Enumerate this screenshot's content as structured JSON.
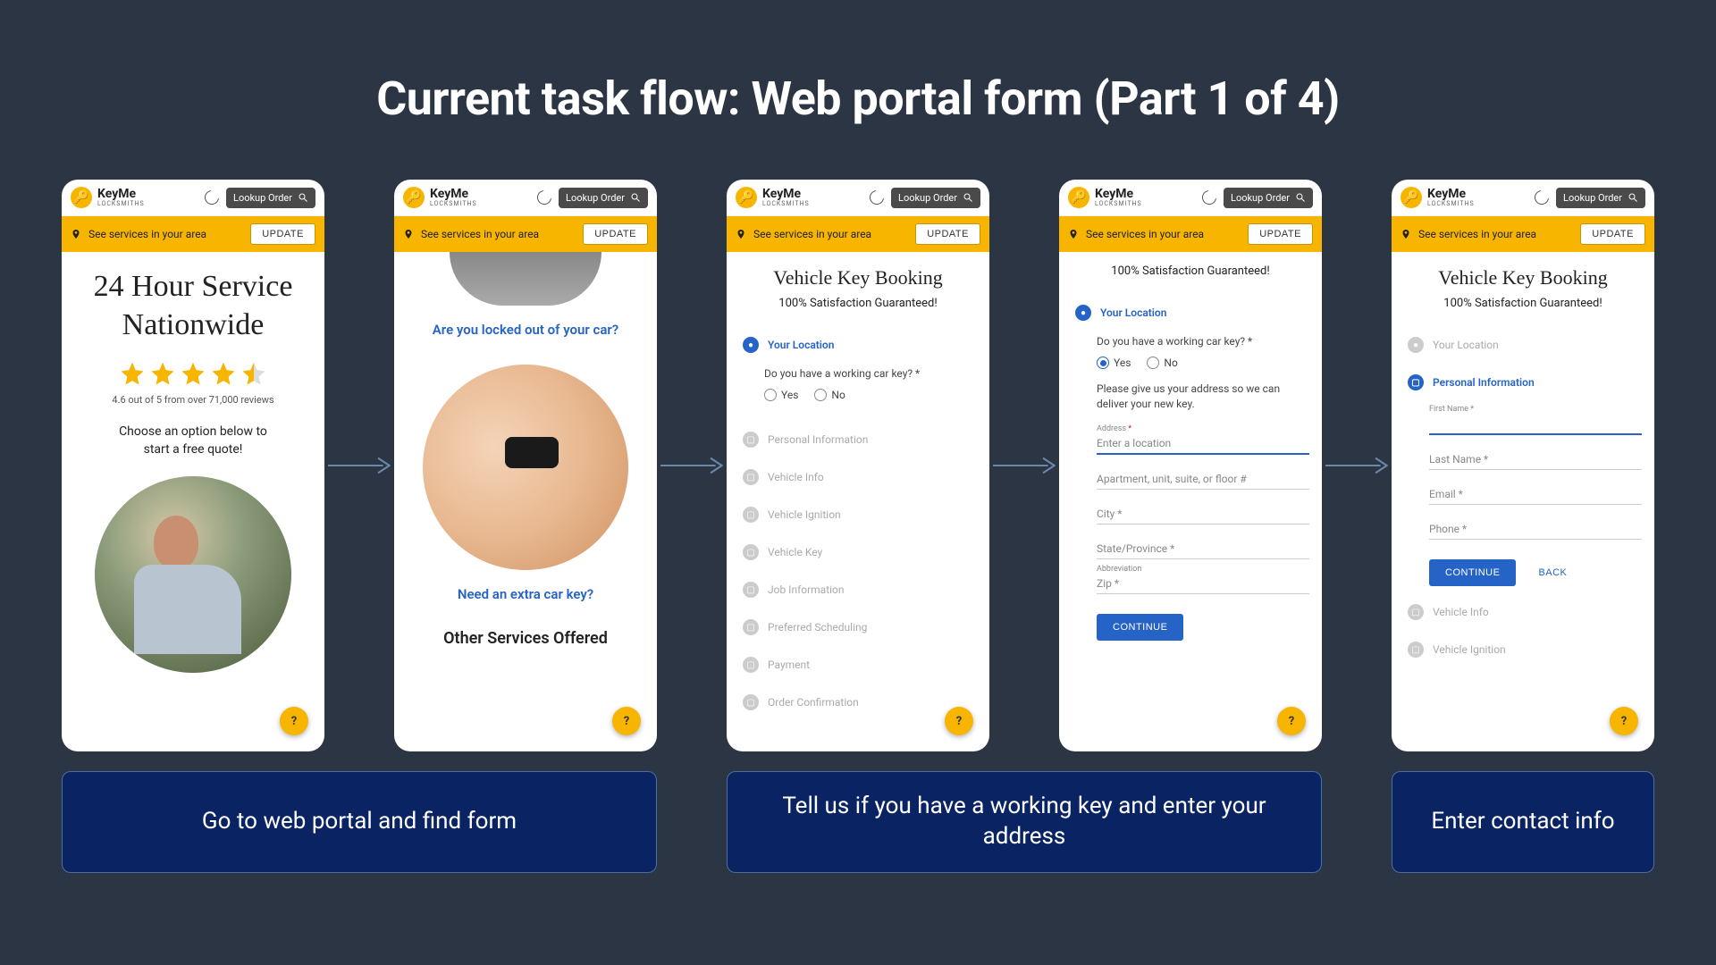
{
  "title": "Current task flow: Web portal form (Part 1 of 4)",
  "brand": {
    "name": "KeyMe",
    "sub": "LOCKSMITHS"
  },
  "header": {
    "lookup": "Lookup Order"
  },
  "banner": {
    "text": "See services in your area",
    "button": "UPDATE"
  },
  "help": "?",
  "p1": {
    "headline": "24 Hour Service Nationwide",
    "rating": "4.6 out of 5 from over 71,000 reviews",
    "sub": "Choose an option below to start a free quote!"
  },
  "p2": {
    "q1": "Are you locked out of your car?",
    "q2": "Need an extra car key?",
    "other": "Other Services Offered"
  },
  "form": {
    "title": "Vehicle Key Booking",
    "sub": "100% Satisfaction Guaranteed!",
    "steps": {
      "location": "Your Location",
      "personal": "Personal Information",
      "vinfo": "Vehicle Info",
      "vignition": "Vehicle Ignition",
      "vkey": "Vehicle Key",
      "job": "Job Information",
      "sched": "Preferred Scheduling",
      "payment": "Payment",
      "confirm": "Order Confirmation"
    },
    "q_working": "Do you have a working car key? *",
    "yes": "Yes",
    "no": "No",
    "deliver_text": "Please give us your address so we can deliver your new key.",
    "fields": {
      "address": "Address",
      "address_ph": "Enter a location",
      "apt": "Apartment, unit, suite, or floor #",
      "city": "City *",
      "state": "State/Province *",
      "abbrev": "Abbreviation",
      "zip": "Zip *",
      "first": "First Name *",
      "last": "Last Name *",
      "email": "Email *",
      "phone": "Phone *"
    },
    "continue": "CONTINUE",
    "back": "BACK"
  },
  "captions": {
    "c1": "Go to web portal and find form",
    "c2": "Tell us if you have a working key and enter your address",
    "c3": "Enter contact info"
  }
}
